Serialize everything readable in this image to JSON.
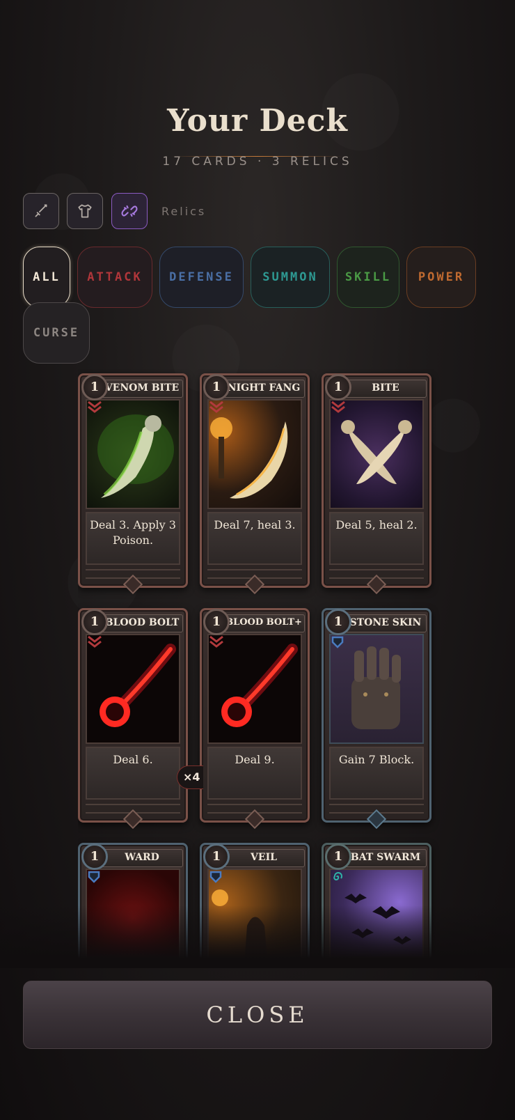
{
  "header": {
    "title": "Your Deck",
    "subtitle": "17 CARDS · 3 RELICS"
  },
  "view_toggles": [
    {
      "icon": "sword-icon",
      "active": false
    },
    {
      "icon": "shirt-icon",
      "active": false
    },
    {
      "icon": "chain-link-icon",
      "active": true
    }
  ],
  "relics_label": "Relics",
  "filters": [
    {
      "label": "ALL",
      "color": "#efe3cf",
      "active": true
    },
    {
      "label": "ATTACK",
      "color": "#b0363a",
      "active": false
    },
    {
      "label": "DEFENSE",
      "color": "#4a6fa5",
      "active": false
    },
    {
      "label": "SUMMON",
      "color": "#2e9a93",
      "active": false
    },
    {
      "label": "SKILL",
      "color": "#4a9a45",
      "active": false
    },
    {
      "label": "POWER",
      "color": "#c06a30",
      "active": false
    },
    {
      "label": "CURSE",
      "color": "#8d8682",
      "active": false
    }
  ],
  "cards": [
    {
      "cost": "1",
      "name": "VENOM BITE",
      "text": "Deal 3. Apply 3 Poison.",
      "type": "attack",
      "art": "green-venom-fang-art"
    },
    {
      "cost": "1",
      "name": "NIGHT FANG",
      "text": "Deal 7, heal 3.",
      "type": "attack",
      "art": "torch-fang-art"
    },
    {
      "cost": "1",
      "name": "BITE",
      "text": "Deal 5, heal 2.",
      "type": "attack",
      "art": "crossed-fangs-art"
    },
    {
      "cost": "1",
      "name": "BLOOD BOLT",
      "text": "Deal 6.",
      "type": "attack",
      "art": "blood-comet-art"
    },
    {
      "cost": "1",
      "name": "BLOOD BOLT+",
      "text": "Deal 9.",
      "type": "attack",
      "art": "blood-comet-art"
    },
    {
      "cost": "1",
      "name": "STONE SKIN",
      "text": "Gain 7 Block.",
      "type": "defense",
      "art": "stone-gauntlet-art"
    },
    {
      "cost": "1",
      "name": "WARD",
      "text": "",
      "type": "defense",
      "art": "red-ward-art"
    },
    {
      "cost": "1",
      "name": "VEIL",
      "text": "",
      "type": "defense",
      "art": "cloaked-figure-art"
    },
    {
      "cost": "1",
      "name": "BAT SWARM",
      "text": "",
      "type": "summon",
      "art": "bat-swarm-art"
    }
  ],
  "count_badge": "×4",
  "close_label": "CLOSE"
}
